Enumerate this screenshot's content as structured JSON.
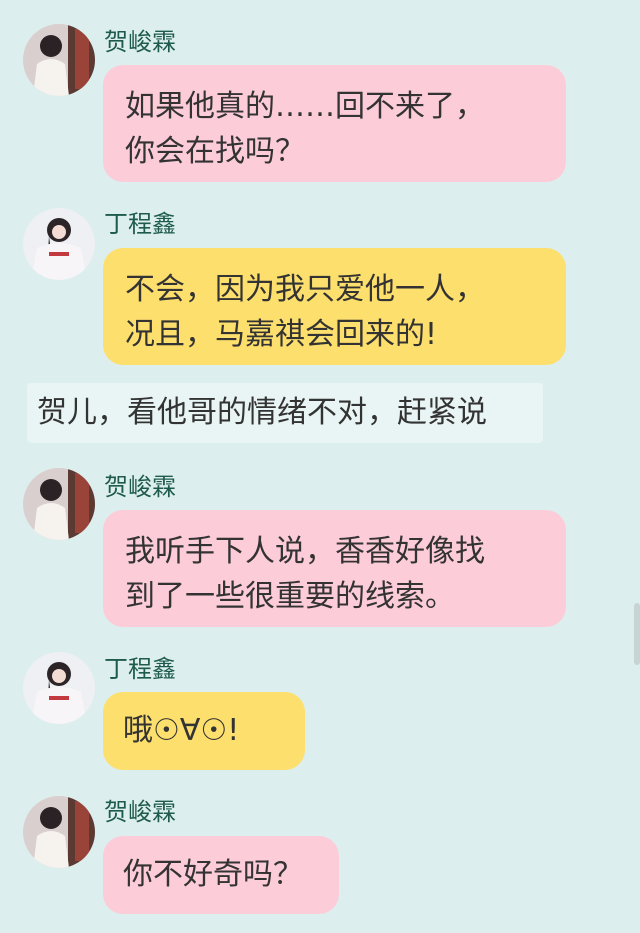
{
  "messages": [
    {
      "sender": "贺峻霖",
      "text": "如果他真的……回不来了，\n你会在找吗？",
      "color": "pink"
    },
    {
      "sender": "丁程鑫",
      "text": "不会，因为我只爱他一人，\n况且，马嘉祺会回来的!",
      "color": "yellow"
    },
    {
      "narration": "贺儿，看他哥的情绪不对，赶紧说"
    },
    {
      "sender": "贺峻霖",
      "text": "我听手下人说，香香好像找\n到了一些很重要的线索。",
      "color": "pink"
    },
    {
      "sender": "丁程鑫",
      "text": "哦☉∀☉!",
      "color": "yellow"
    },
    {
      "sender": "贺峻霖",
      "text": "你不好奇吗？",
      "color": "pink"
    }
  ],
  "colors": {
    "background": "#dcefee",
    "pink_bubble": "#fdccd9",
    "yellow_bubble": "#fddf6d",
    "name_text": "#1f5b4d"
  }
}
